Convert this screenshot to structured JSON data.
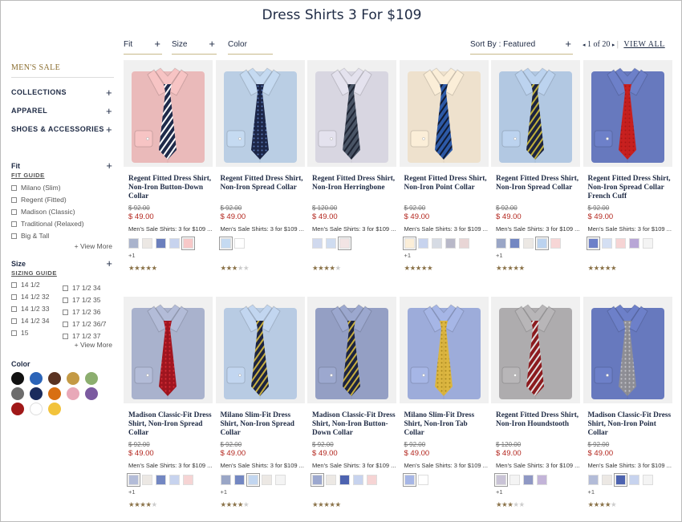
{
  "page_title": "Dress Shirts 3 For $109",
  "filters": [
    {
      "label": "Fit"
    },
    {
      "label": "Size"
    },
    {
      "label": "Color"
    }
  ],
  "sort": {
    "label": "Sort By : Featured"
  },
  "pager": {
    "text": "1 of 20",
    "view_all": "VIEW ALL"
  },
  "sidebar": {
    "section_title": "MEN'S SALE",
    "categories": [
      "COLLECTIONS",
      "APPAREL",
      "SHOES & ACCESSORIES"
    ],
    "fit": {
      "title": "Fit",
      "guide": "FIT GUIDE",
      "options": [
        "Milano (Slim)",
        "Regent (Fitted)",
        "Madison (Classic)",
        "Traditional (Relaxed)",
        "Big & Tall"
      ],
      "view_more": "+ View More"
    },
    "size": {
      "title": "Size",
      "guide": "SIZING GUIDE",
      "col1": [
        "14 1/2",
        "14 1/2 32",
        "14 1/2 33",
        "14 1/2 34",
        "15"
      ],
      "col2": [
        "17 1/2 34",
        "17 1/2 35",
        "17 1/2 36",
        "17 1/2 36/7",
        "17 1/2 37"
      ],
      "view_more": "+ View More"
    },
    "color": {
      "title": "Color",
      "swatches": [
        "#111111",
        "#2b64b8",
        "#5a3322",
        "#c49a45",
        "#8cae6f",
        "#6d6d6d",
        "#1a2b5c",
        "#d86f12",
        "#e8a8b8",
        "#7b5aa0",
        "#a01818",
        "#ffffff",
        "#f2c33c"
      ]
    }
  },
  "products": [
    {
      "name": "Regent Fitted Dress Shirt, Non-Iron Button-Down Collar",
      "old_price": "$ 92.00",
      "price": "$ 49.00",
      "promo": "Men's Sale Shirts: 3 for $109 ...",
      "shirt": "#f7c4c4",
      "tie": "#1f2a4a",
      "stripe": "#ffffff",
      "pattern": "stripe",
      "swatches": [
        "#a9b3cc",
        "#ece8e4",
        "#6b7fbd",
        "#c7d3ee",
        "#f7c8c8"
      ],
      "selected": 4,
      "more": "+1",
      "rating": 4.5
    },
    {
      "name": "Regent Fitted Dress Shirt, Non-Iron Spread Collar",
      "old_price": "$ 92.00",
      "price": "$ 49.00",
      "promo": "Men's Sale Shirts: 3 for $109 ...",
      "shirt": "#c5daf1",
      "tie": "#1c2647",
      "stripe": "#5a79b8",
      "pattern": "dots",
      "swatches": [
        "#c5daf1",
        "#ffffff"
      ],
      "selected": 0,
      "more": "",
      "rating": 3
    },
    {
      "name": "Regent Fitted Dress Shirt, Non-Iron Herringbone",
      "old_price": "$ 120.00",
      "price": "$ 49.00",
      "promo": "Men's Sale Shirts: 3 for $109 ...",
      "shirt": "#e4e2ee",
      "tie": "#4a5566",
      "stripe": "#1e2433",
      "pattern": "stripe",
      "swatches": [
        "#d0d9ee",
        "#cfdcf0",
        "#f2e4e4"
      ],
      "selected": 2,
      "more": "",
      "rating": 4
    },
    {
      "name": "Regent Fitted Dress Shirt, Non-Iron Point Collar",
      "old_price": "$ 92.00",
      "price": "$ 49.00",
      "promo": "Men's Sale Shirts: 3 for $109 ...",
      "shirt": "#fbeed8",
      "tie": "#2d5aa8",
      "stripe": "#111b33",
      "pattern": "stripe",
      "swatches": [
        "#fbeed8",
        "#c7d3ee",
        "#d6dbe4",
        "#b8b8c8",
        "#e8d5d5"
      ],
      "selected": 0,
      "more": "+1",
      "rating": 4.5
    },
    {
      "name": "Regent Fitted Dress Shirt, Non-Iron Spread Collar",
      "old_price": "$ 92.00",
      "price": "$ 49.00",
      "promo": "Men's Sale Shirts: 3 for $109 ...",
      "shirt": "#bcd3ef",
      "tie": "#1d2440",
      "stripe": "#c2b23c",
      "pattern": "stripe",
      "swatches": [
        "#9aa6c6",
        "#7387c2",
        "#ece8e4",
        "#bcd3ef",
        "#f7d6d6"
      ],
      "selected": 3,
      "more": "+1",
      "rating": 4.5
    },
    {
      "name": "Regent Fitted Dress Shirt, Non-Iron Spread Collar French Cuff",
      "old_price": "$ 92.00",
      "price": "$ 49.00",
      "promo": "Men's Sale Shirts: 3 for $109 ...",
      "shirt": "#6d80c9",
      "tie": "#c8201f",
      "stripe": "#a81515",
      "pattern": "dots",
      "swatches": [
        "#6d80c9",
        "#d4dff3",
        "#f6d4d4",
        "#b8a6d6",
        "#f4f4f4"
      ],
      "selected": 0,
      "more": "",
      "rating": 4.5
    },
    {
      "name": "Madison Classic-Fit Dress Shirt, Non-Iron Spread Collar",
      "old_price": "$ 92.00",
      "price": "$ 49.00",
      "promo": "Men's Sale Shirts: 3 for $109 ...",
      "shirt": "#b3bcd8",
      "tie": "#a0151f",
      "stripe": "#d8303a",
      "pattern": "dots",
      "swatches": [
        "#b3bcd8",
        "#ece8e4",
        "#7387c2",
        "#c7d3ee",
        "#f6d4d4"
      ],
      "selected": 0,
      "more": "+1",
      "rating": 4
    },
    {
      "name": "Milano Slim-Fit Dress Shirt, Non-Iron Spread Collar",
      "old_price": "$ 92.00",
      "price": "$ 49.00",
      "promo": "Men's Sale Shirts: 3 for $109 ...",
      "shirt": "#c2d6f0",
      "tie": "#1d2440",
      "stripe": "#c9b040",
      "pattern": "stripe",
      "swatches": [
        "#9aa6c6",
        "#7387c2",
        "#c2d6f0",
        "#ece8e4",
        "#f4f4f4"
      ],
      "selected": 2,
      "more": "+1",
      "rating": 3.5
    },
    {
      "name": "Madison Classic-Fit Dress Shirt, Non-Iron Button-Down Collar",
      "old_price": "$ 92.00",
      "price": "$ 49.00",
      "promo": "Men's Sale Shirts: 3 for $109 ...",
      "shirt": "#9ca8cf",
      "tie": "#1d2440",
      "stripe": "#c9b040",
      "pattern": "stripe",
      "swatches": [
        "#9ca8cf",
        "#ece8e4",
        "#4d63b0",
        "#c7d3ee",
        "#f6d4d4"
      ],
      "selected": 0,
      "more": "",
      "rating": 4.5
    },
    {
      "name": "Milano Slim-Fit Dress Shirt, Non-Iron Tab Collar",
      "old_price": "$ 92.00",
      "price": "$ 49.00",
      "promo": "Men's Sale Shirts: 3 for $109 ...",
      "shirt": "#a6b6e6",
      "tie": "#dcb640",
      "stripe": "#a8861e",
      "pattern": "dots",
      "swatches": [
        "#a6b6e6",
        "#ffffff"
      ],
      "selected": 0,
      "more": "",
      "rating": 0
    },
    {
      "name": "Regent Fitted Dress Shirt, Non-Iron Houndstooth",
      "old_price": "$ 120.00",
      "price": "$ 49.00",
      "promo": "Men's Sale Shirts: 3 for $109 ...",
      "shirt": "#b8b6b8",
      "tie": "#8d1b1f",
      "stripe": "#e2e2e2",
      "pattern": "stripe",
      "swatches": [
        "#c9c3d6",
        "#f4f4f4",
        "#8f98c4",
        "#c3b4d8"
      ],
      "selected": 0,
      "more": "+1",
      "rating": 2.5
    },
    {
      "name": "Madison Classic-Fit Dress Shirt, Non-Iron Point Collar",
      "old_price": "$ 92.00",
      "price": "$ 49.00",
      "promo": "Men's Sale Shirts: 3 for $109 ...",
      "shirt": "#6d80c9",
      "tie": "#8e8e95",
      "stripe": "#c7c7cc",
      "pattern": "dots",
      "swatches": [
        "#b3bcd8",
        "#ece8e4",
        "#4d63b0",
        "#c7d3ee",
        "#f4f4f4"
      ],
      "selected": 2,
      "more": "+1",
      "rating": 4
    }
  ]
}
